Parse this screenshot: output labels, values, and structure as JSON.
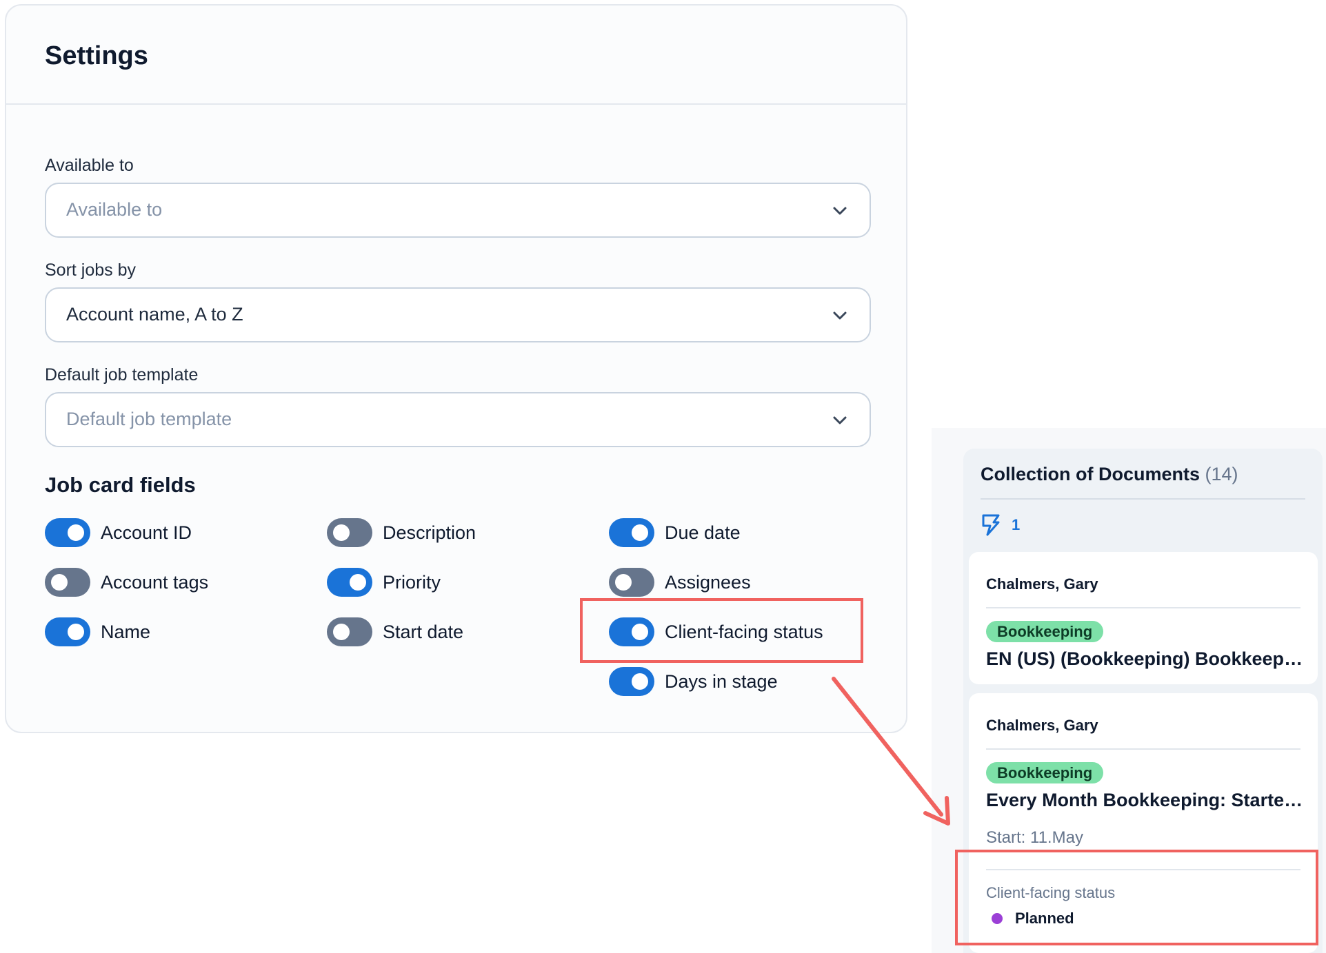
{
  "settings": {
    "title": "Settings",
    "available_to": {
      "label": "Available to",
      "placeholder": "Available to"
    },
    "sort_jobs_by": {
      "label": "Sort jobs by",
      "value": "Account name, A to Z"
    },
    "default_job_template": {
      "label": "Default job template",
      "placeholder": "Default job template"
    },
    "job_card_fields": {
      "title": "Job card fields",
      "fields": [
        {
          "label": "Account ID",
          "enabled": true
        },
        {
          "label": "Account tags",
          "enabled": false
        },
        {
          "label": "Name",
          "enabled": true
        },
        {
          "label": "Description",
          "enabled": false
        },
        {
          "label": "Priority",
          "enabled": true
        },
        {
          "label": "Start date",
          "enabled": false
        },
        {
          "label": "Due date",
          "enabled": true
        },
        {
          "label": "Assignees",
          "enabled": false
        },
        {
          "label": "Client-facing status",
          "enabled": true
        },
        {
          "label": "Days in stage",
          "enabled": true
        }
      ]
    }
  },
  "column": {
    "title": "Collection of Documents",
    "count": "(14)",
    "automation_icon": "lightning-bolt-icon",
    "automation_count": "1",
    "cards": [
      {
        "account": "Chalmers, Gary",
        "tag": "Bookkeeping",
        "title": "EN (US) (Bookkeeping) Bookkeeping"
      },
      {
        "account": "Chalmers, Gary",
        "tag": "Bookkeeping",
        "title": "Every Month Bookkeeping: Started on the first day of the month",
        "start": "Start: 11.May",
        "client_facing_status_label": "Client-facing status",
        "client_facing_status": "Planned"
      }
    ]
  },
  "colors": {
    "accent": "#1a73d8",
    "toggle_off": "#66758c",
    "highlight": "#f0625f",
    "tag_bg": "#7de0a8",
    "status_planned": "#9b3fd6"
  }
}
